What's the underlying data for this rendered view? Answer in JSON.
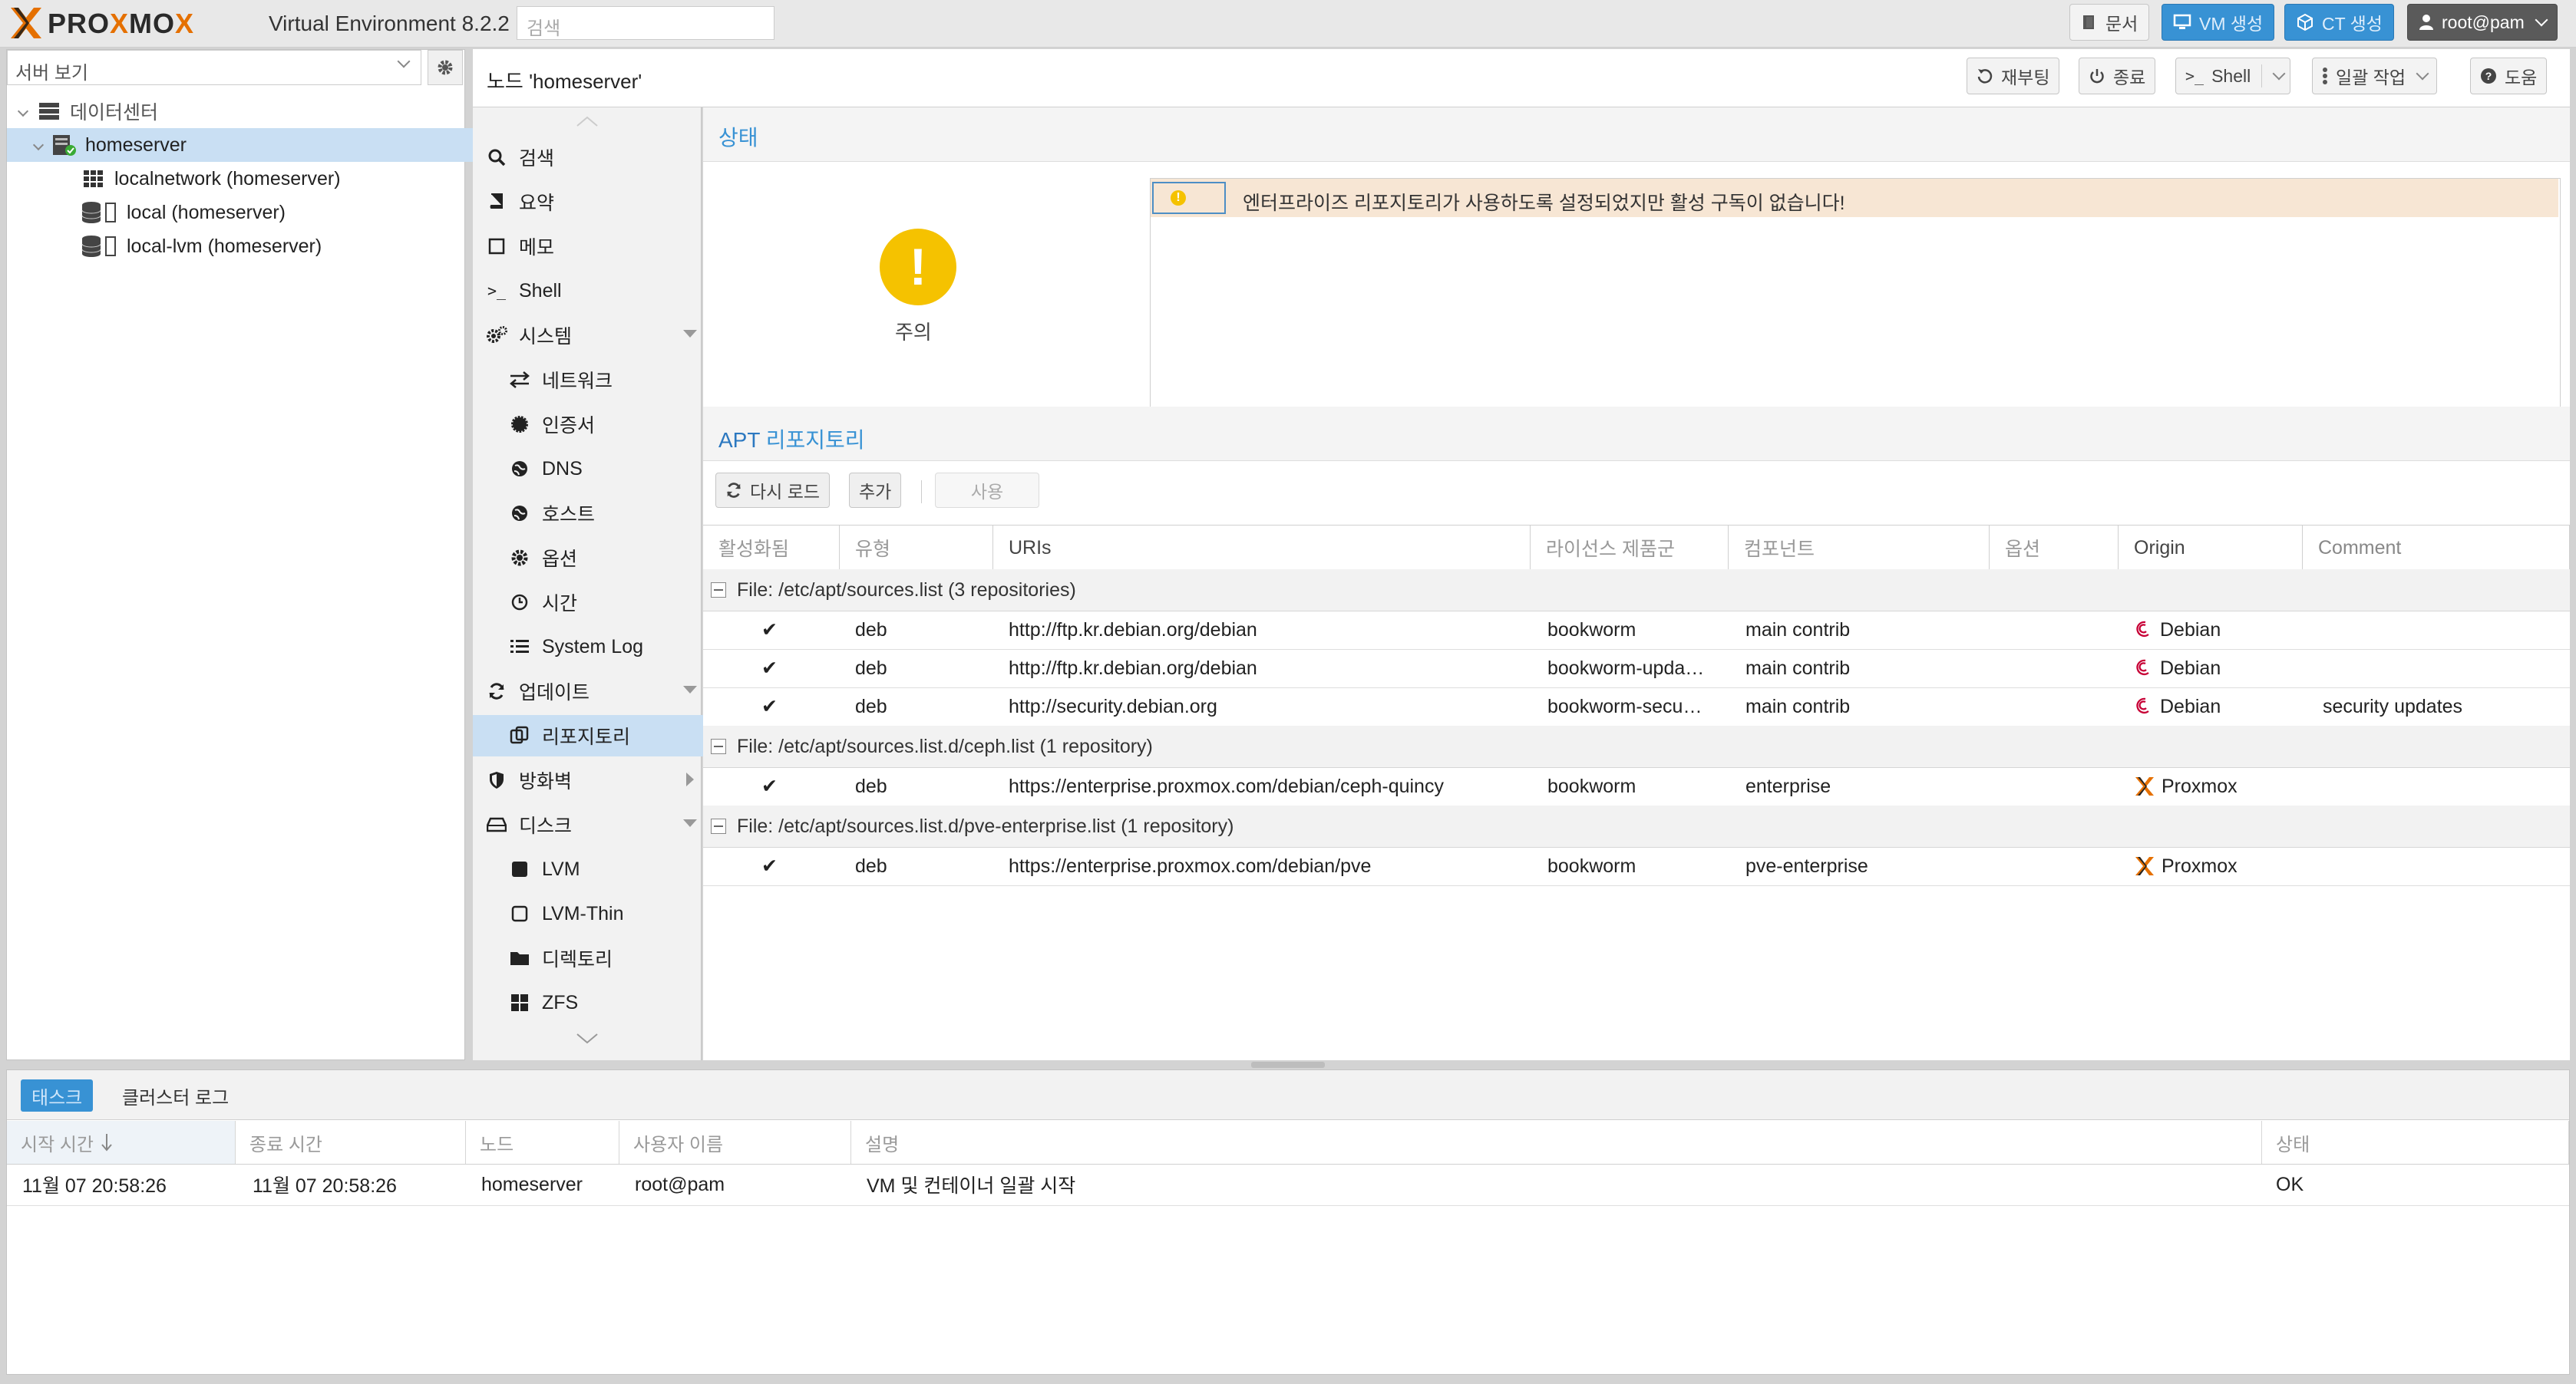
{
  "topbar": {
    "logo_prefix": "PRO",
    "logo_x": "X",
    "logo_suffix": "MO",
    "logo_x2": "X",
    "product": "Virtual Environment 8.2.2",
    "search_placeholder": "검색",
    "docs_label": "문서",
    "create_vm_label": "VM 생성",
    "create_ct_label": "CT 생성",
    "user_label": "root@pam"
  },
  "left": {
    "view_label": "서버 보기",
    "tree": [
      {
        "label": "데이터센터",
        "icon": "datacenter-icon"
      },
      {
        "label": "homeserver",
        "icon": "server-icon",
        "selected": true
      },
      {
        "label": "localnetwork (homeserver)",
        "icon": "network-icon"
      },
      {
        "label": "local (homeserver)",
        "icon": "storage-icon"
      },
      {
        "label": "local-lvm (homeserver)",
        "icon": "storage-icon"
      }
    ]
  },
  "header": {
    "title": "노드 'homeserver'",
    "reboot_label": "재부팅",
    "shutdown_label": "종료",
    "shell_label": "Shell",
    "bulk_label": "일괄 작업",
    "help_label": "도움"
  },
  "nav": {
    "items": [
      {
        "label": "검색",
        "icon": "search-icon"
      },
      {
        "label": "요약",
        "icon": "book-icon"
      },
      {
        "label": "메모",
        "icon": "note-icon"
      },
      {
        "label": "Shell",
        "icon": "terminal-icon"
      },
      {
        "label": "시스템",
        "icon": "cogs-icon",
        "expanded": true
      },
      {
        "label": "네트워크",
        "icon": "exchange-icon",
        "sub": true
      },
      {
        "label": "인증서",
        "icon": "certificate-icon",
        "sub": true
      },
      {
        "label": "DNS",
        "icon": "globe-icon",
        "sub": true
      },
      {
        "label": "호스트",
        "icon": "globe-icon",
        "sub": true
      },
      {
        "label": "옵션",
        "icon": "gear-icon",
        "sub": true
      },
      {
        "label": "시간",
        "icon": "clock-icon",
        "sub": true
      },
      {
        "label": "System Log",
        "icon": "list-icon",
        "sub": true
      },
      {
        "label": "업데이트",
        "icon": "refresh-icon",
        "expanded": true
      },
      {
        "label": "리포지토리",
        "icon": "repository-icon",
        "sub": true,
        "selected": true
      },
      {
        "label": "방화벽",
        "icon": "shield-icon",
        "collapsed": true
      },
      {
        "label": "디스크",
        "icon": "hdd-icon",
        "expanded": true
      },
      {
        "label": "LVM",
        "icon": "square-icon",
        "sub": true
      },
      {
        "label": "LVM-Thin",
        "icon": "square-outline-icon",
        "sub": true
      },
      {
        "label": "디렉토리",
        "icon": "folder-icon",
        "sub": true
      },
      {
        "label": "ZFS",
        "icon": "grid-icon",
        "sub": true
      }
    ]
  },
  "status": {
    "title": "상태",
    "icon_label": "주의",
    "warning_text": "엔터프라이즈 리포지토리가 사용하도록 설정되었지만 활성 구독이 없습니다!"
  },
  "apt": {
    "title_apt": "APT",
    "title_rest": "리포지토리",
    "reload_label": "다시 로드",
    "add_label": "추가",
    "enable_label": "사용",
    "columns": [
      "활성화됨",
      "유형",
      "URIs",
      "라이선스 제품군",
      "컴포넌트",
      "옵션",
      "Origin",
      "Comment"
    ],
    "groups": [
      {
        "title": "File: /etc/apt/sources.list (3 repositories)",
        "rows": [
          {
            "enabled": "✔",
            "type": "deb",
            "uri": "http://ftp.kr.debian.org/debian",
            "suite": "bookworm",
            "component": "main contrib",
            "option": "",
            "origin": "Debian",
            "comment": ""
          },
          {
            "enabled": "✔",
            "type": "deb",
            "uri": "http://ftp.kr.debian.org/debian",
            "suite": "bookworm-upda…",
            "component": "main contrib",
            "option": "",
            "origin": "Debian",
            "comment": ""
          },
          {
            "enabled": "✔",
            "type": "deb",
            "uri": "http://security.debian.org",
            "suite": "bookworm-secu…",
            "component": "main contrib",
            "option": "",
            "origin": "Debian",
            "comment": "security updates"
          }
        ]
      },
      {
        "title": "File: /etc/apt/sources.list.d/ceph.list (1 repository)",
        "rows": [
          {
            "enabled": "✔",
            "type": "deb",
            "uri": "https://enterprise.proxmox.com/debian/ceph-quincy",
            "suite": "bookworm",
            "component": "enterprise",
            "option": "",
            "origin": "Proxmox",
            "comment": ""
          }
        ]
      },
      {
        "title": "File: /etc/apt/sources.list.d/pve-enterprise.list (1 repository)",
        "rows": [
          {
            "enabled": "✔",
            "type": "deb",
            "uri": "https://enterprise.proxmox.com/debian/pve",
            "suite": "bookworm",
            "component": "pve-enterprise",
            "option": "",
            "origin": "Proxmox",
            "comment": ""
          }
        ]
      }
    ]
  },
  "bottom": {
    "tab_tasks": "태스크",
    "tab_cluster_log": "클러스터 로그",
    "columns": [
      "시작 시간",
      "종료 시간",
      "노드",
      "사용자 이름",
      "설명",
      "상태"
    ],
    "rows": [
      {
        "start": "11월 07 20:58:26",
        "end": "11월 07 20:58:26",
        "node": "homeserver",
        "user": "root@pam",
        "desc": "VM 및 컨테이너 일괄 시작",
        "status": "OK"
      }
    ]
  },
  "colors": {
    "accent": "#3892d4",
    "logo_orange": "#e57000",
    "warn": "#f5c200",
    "selection": "#c9dff3"
  }
}
